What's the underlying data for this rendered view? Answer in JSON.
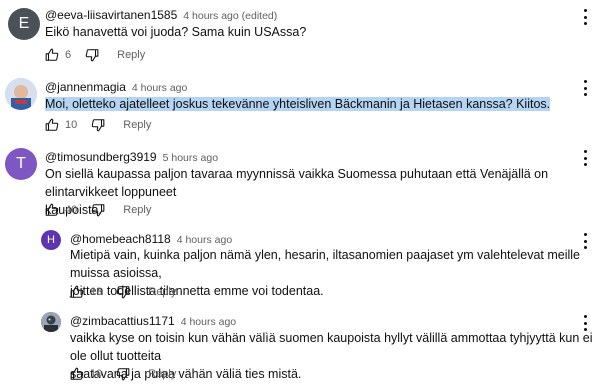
{
  "comments": [
    {
      "initial": "E",
      "avatar_color": "#4a5159",
      "handle": "@eeva-liisavirtanen1585",
      "time": "4 hours ago (edited)",
      "text": "Eikö hanavettä voi juoda? Sama kuin USAssa?",
      "likes": "6",
      "reply_label": "Reply"
    },
    {
      "initial": "",
      "avatar_color": "#c9d3e6",
      "handle": "@jannenmagia",
      "time": "4 hours ago",
      "text": "Moi, oletteko ajatelleet joskus tekevänne yhteisliven Bäckmanin ja Hietasen kanssa? Kiitos.",
      "likes": "10",
      "reply_label": "Reply"
    },
    {
      "initial": "T",
      "avatar_color": "#7e57c2",
      "handle": "@timosundberg3919",
      "time": "5 hours ago",
      "text_line1": "On siellä kaupassa paljon tavaraa myynnissä vaikka Suomessa puhutaan että Venäjällä on elintarvikkeet loppuneet",
      "text_line2": "kaupoista.",
      "likes": "40",
      "reply_label": "Reply"
    },
    {
      "initial": "H",
      "avatar_color": "#5e35b1",
      "handle": "@homebeach8118",
      "time": "4 hours ago",
      "text_line1": "Mietipä vain, kuinka paljon nämä ylen, hesarin, iltasanomien paajaset ym valehtelevat meille muissa asioissa,",
      "text_line2": "joitten todellista tilannetta emme voi todentaa.",
      "likes": "13",
      "reply_label": "Reply"
    },
    {
      "initial": "",
      "avatar_color": "#3d4450",
      "handle": "@zimbacattius1171",
      "time": "4 hours ago",
      "text_line1": "vaikka kyse on toisin kun vähän välìä suomen kaupoista hyllyt välillä ammottaa tyhjyyttä kun ei ole ollut tuotteita",
      "text_line2": "saatavana ja pulaa vähän väliä ties mistä.",
      "likes": "10",
      "reply_label": "Reply"
    }
  ]
}
